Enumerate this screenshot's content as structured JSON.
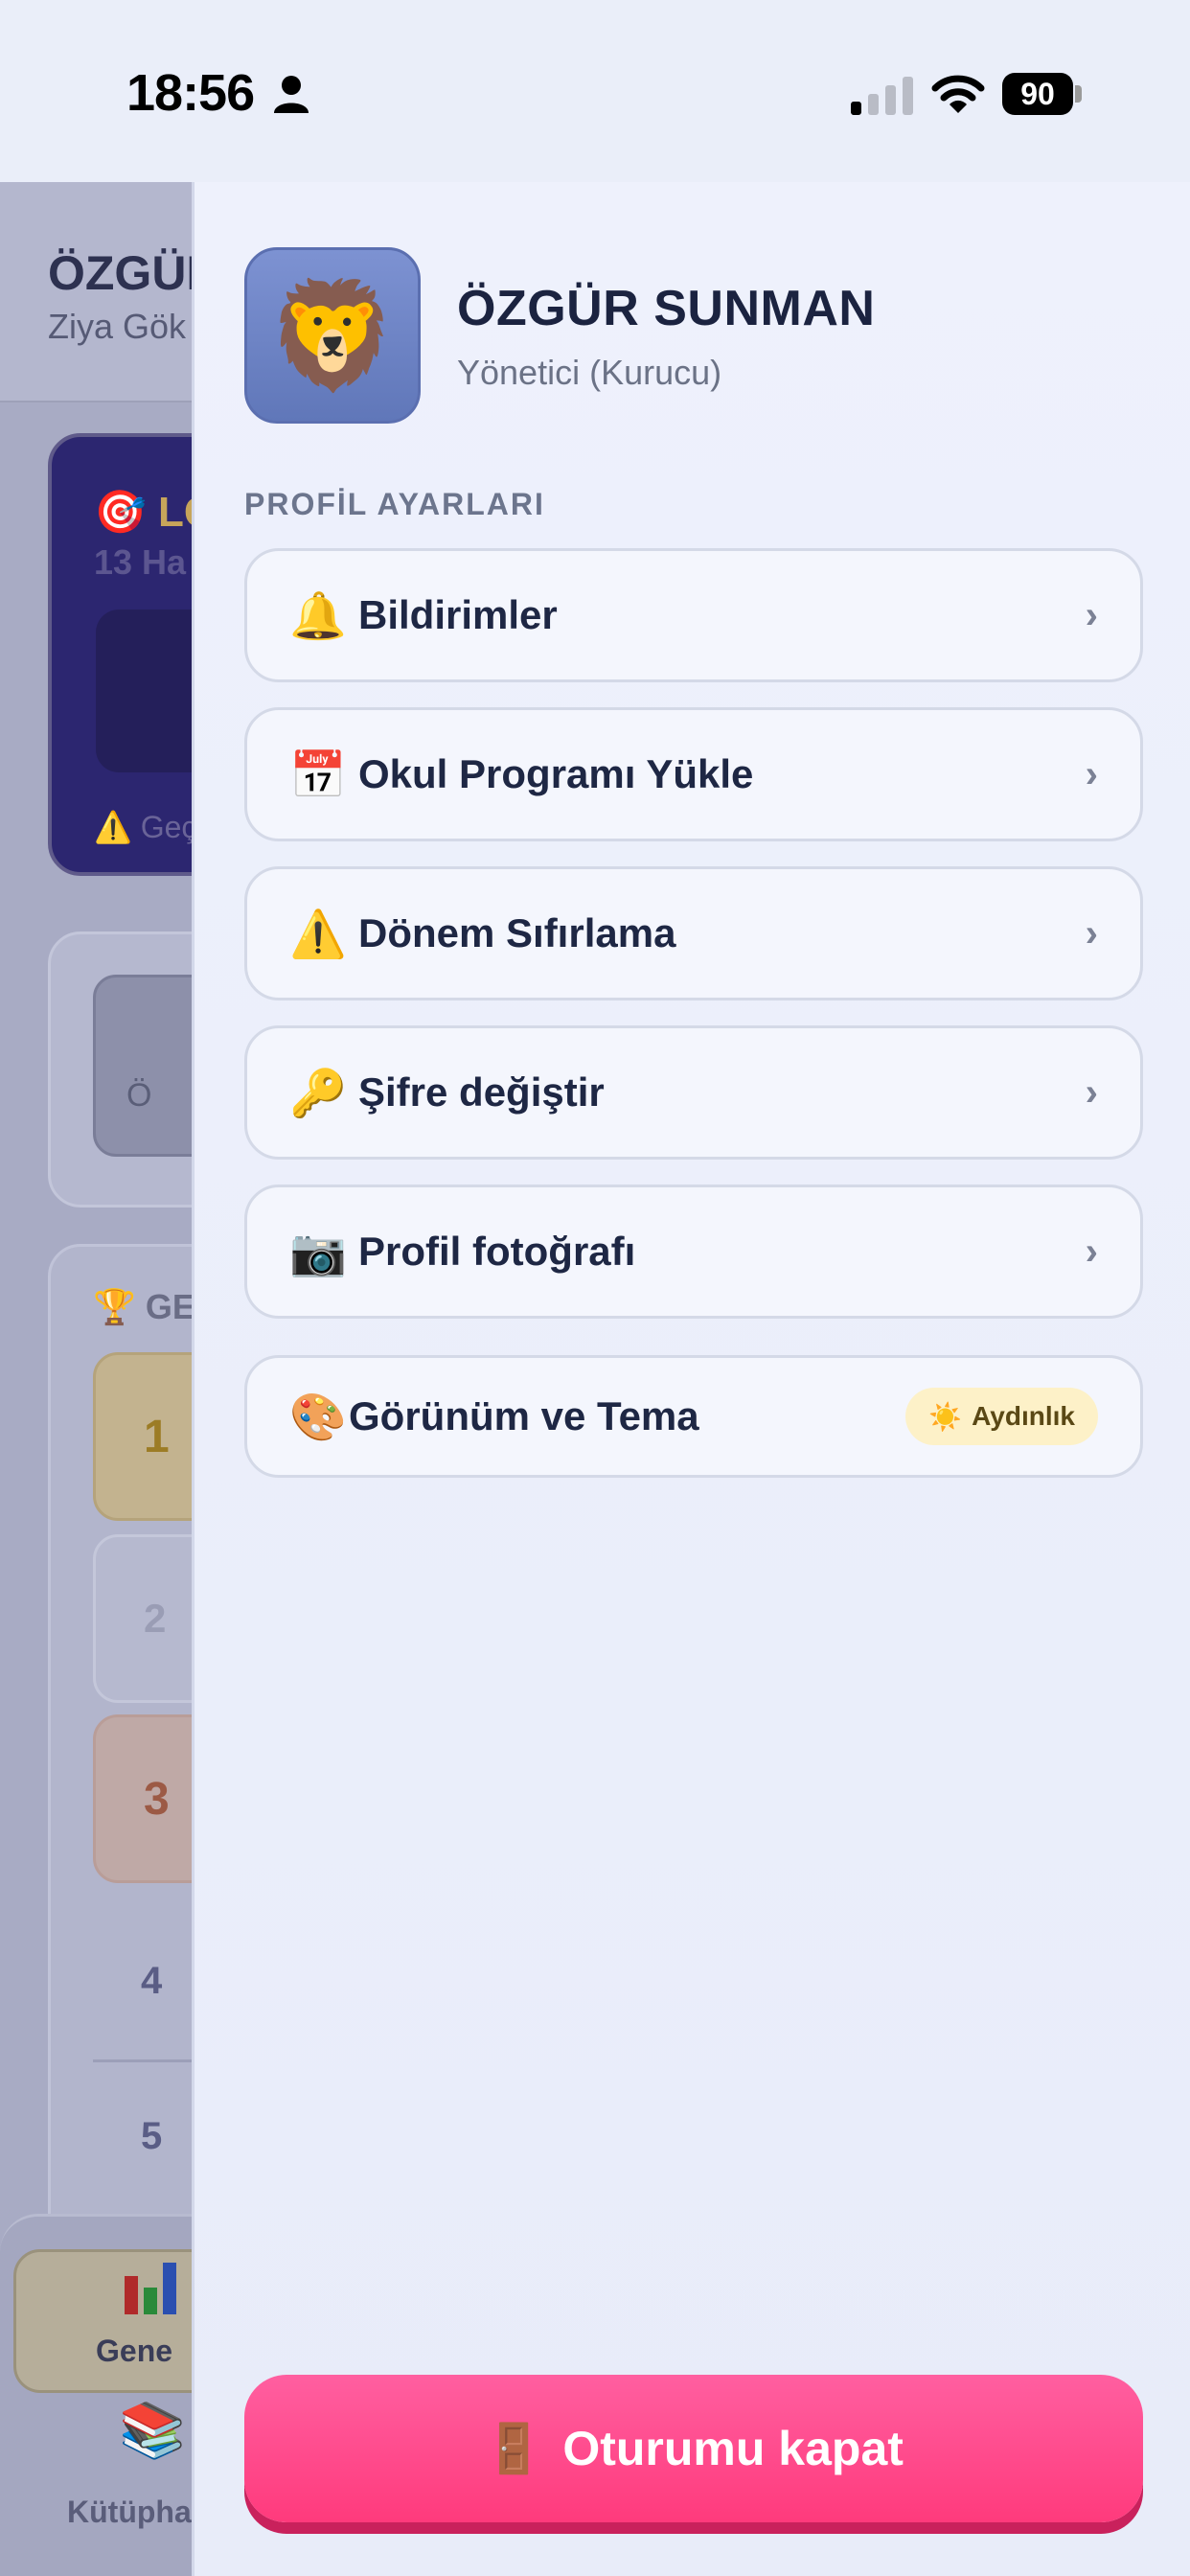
{
  "status_bar": {
    "time": "18:56",
    "battery": "90",
    "icons": [
      "person-icon",
      "signal-icon",
      "wifi-icon",
      "battery-icon"
    ]
  },
  "background_app": {
    "title": "ÖZGÜR",
    "subtitle": "Ziya Gök",
    "lgs_card": {
      "title": "LG",
      "date": "13 Ha",
      "note": "Geç"
    },
    "card2_text": "Ö",
    "ranking_title": "GE",
    "ranks": [
      "1",
      "2",
      "3",
      "4",
      "5"
    ],
    "tabs": {
      "active_label": "Gene",
      "second_label": "Kütüpha"
    }
  },
  "drawer": {
    "profile": {
      "avatar": "🦁",
      "name": "ÖZGÜR SUNMAN",
      "role": "Yönetici (Kurucu)"
    },
    "section_title": "PROFİL AYARLARI",
    "menu": [
      {
        "icon": "🔔",
        "icon_name": "bell-icon",
        "label": "Bildirimler",
        "chevron": "›"
      },
      {
        "icon": "📅",
        "icon_name": "calendar-icon",
        "label": "Okul Programı Yükle",
        "chevron": "›"
      },
      {
        "icon": "⚠️",
        "icon_name": "warning-icon",
        "label": "Dönem Sıfırlama",
        "chevron": "›"
      },
      {
        "icon": "🔑",
        "icon_name": "key-icon",
        "label": "Şifre değiştir",
        "chevron": "›"
      },
      {
        "icon": "📷",
        "icon_name": "camera-icon",
        "label": "Profil fotoğrafı",
        "chevron": "›"
      }
    ],
    "theme": {
      "icon": "🎨",
      "label": "Görünüm ve Tema",
      "badge_icon": "☀️",
      "badge_label": "Aydınlık"
    },
    "logout": {
      "icon": "🚪",
      "label": "Oturumu kapat"
    }
  },
  "colors": {
    "accent_logout": "#ff3a7c",
    "text_primary": "#1e2744",
    "drawer_bg": "#eef1fc"
  }
}
